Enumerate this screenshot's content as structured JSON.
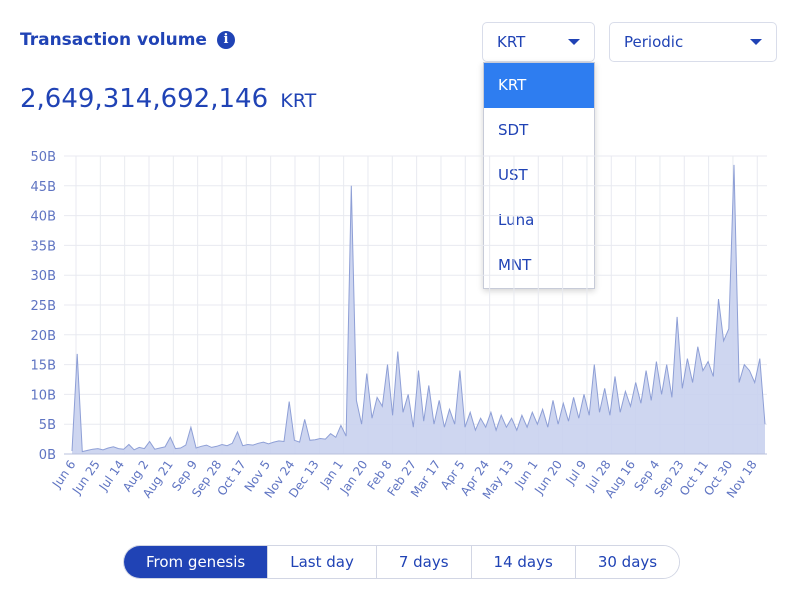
{
  "header": {
    "title": "Transaction volume",
    "info_icon": "info-icon",
    "total_value": "2,649,314,692,146",
    "total_unit": "KRT"
  },
  "currency_select": {
    "value": "KRT",
    "options": [
      "KRT",
      "SDT",
      "UST",
      "Luna",
      "MNT"
    ],
    "active_option": "KRT"
  },
  "period_select": {
    "value": "Periodic"
  },
  "range_buttons": {
    "items": [
      "From genesis",
      "Last day",
      "7 days",
      "14 days",
      "30 days"
    ],
    "active": "From genesis"
  },
  "colors": {
    "accent": "#2043b5",
    "area_fill": "#c9d2ee",
    "area_stroke": "#8e9fd6",
    "grid": "#e8eaf0",
    "active_option": "#2e7df0"
  },
  "chart_data": {
    "type": "area",
    "title": "",
    "xlabel": "",
    "ylabel": "",
    "ylim": [
      0,
      50
    ],
    "yticks": [
      "0B",
      "5B",
      "10B",
      "15B",
      "20B",
      "25B",
      "30B",
      "35B",
      "40B",
      "45B",
      "50B"
    ],
    "xticks": [
      "Jun 6",
      "Jun 25",
      "Jul 14",
      "Aug 2",
      "Aug 21",
      "Sep 9",
      "Sep 28",
      "Oct 17",
      "Nov 5",
      "Nov 24",
      "Dec 13",
      "Jan 1",
      "Jan 20",
      "Feb 8",
      "Feb 27",
      "Mar 17",
      "Apr 5",
      "Apr 24",
      "May 13",
      "Jun 1",
      "Jun 20",
      "Jul 9",
      "Jul 28",
      "Aug 16",
      "Sep 4",
      "Sep 23",
      "Oct 11",
      "Oct 30",
      "Nov 18"
    ],
    "grid": true,
    "series": [
      {
        "values": [
          0.5,
          16.8,
          0.4,
          0.6,
          0.8,
          0.9,
          0.7,
          1.0,
          1.2,
          0.9,
          0.8,
          1.6,
          0.7,
          1.1,
          0.9,
          2.1,
          0.8,
          1.0,
          1.2,
          2.8,
          0.9,
          1.0,
          1.5,
          4.5,
          1.0,
          1.3,
          1.5,
          1.1,
          1.3,
          1.6,
          1.4,
          1.8,
          3.7,
          1.4,
          1.6,
          1.5,
          1.8,
          2.0,
          1.7,
          2.0,
          2.2,
          2.1,
          8.8,
          2.3,
          2.0,
          5.8,
          2.3,
          2.4,
          2.6,
          2.5,
          3.4,
          2.8,
          4.8,
          3.0,
          45.0,
          9.0,
          5.0,
          13.5,
          6.0,
          9.5,
          8.0,
          15.0,
          6.5,
          17.2,
          7.0,
          10.0,
          4.5,
          14.0,
          5.5,
          11.5,
          5.0,
          9.0,
          4.5,
          7.5,
          5.0,
          14.0,
          4.5,
          7.0,
          4.0,
          6.0,
          4.5,
          7.0,
          4.0,
          6.5,
          4.5,
          6.0,
          4.0,
          6.5,
          4.5,
          7.0,
          5.0,
          7.5,
          4.5,
          9.0,
          5.0,
          8.5,
          5.5,
          9.5,
          6.0,
          10.0,
          6.5,
          15.0,
          7.0,
          11.0,
          6.5,
          13.0,
          7.0,
          10.5,
          8.0,
          12.0,
          8.5,
          14.0,
          9.0,
          15.5,
          10.0,
          15.0,
          9.5,
          23.0,
          11.0,
          16.0,
          12.0,
          18.0,
          14.0,
          15.5,
          13.0,
          26.0,
          19.0,
          21.0,
          48.5,
          12.0,
          15.0,
          14.0,
          12.0,
          16.0,
          5.0
        ]
      }
    ]
  }
}
